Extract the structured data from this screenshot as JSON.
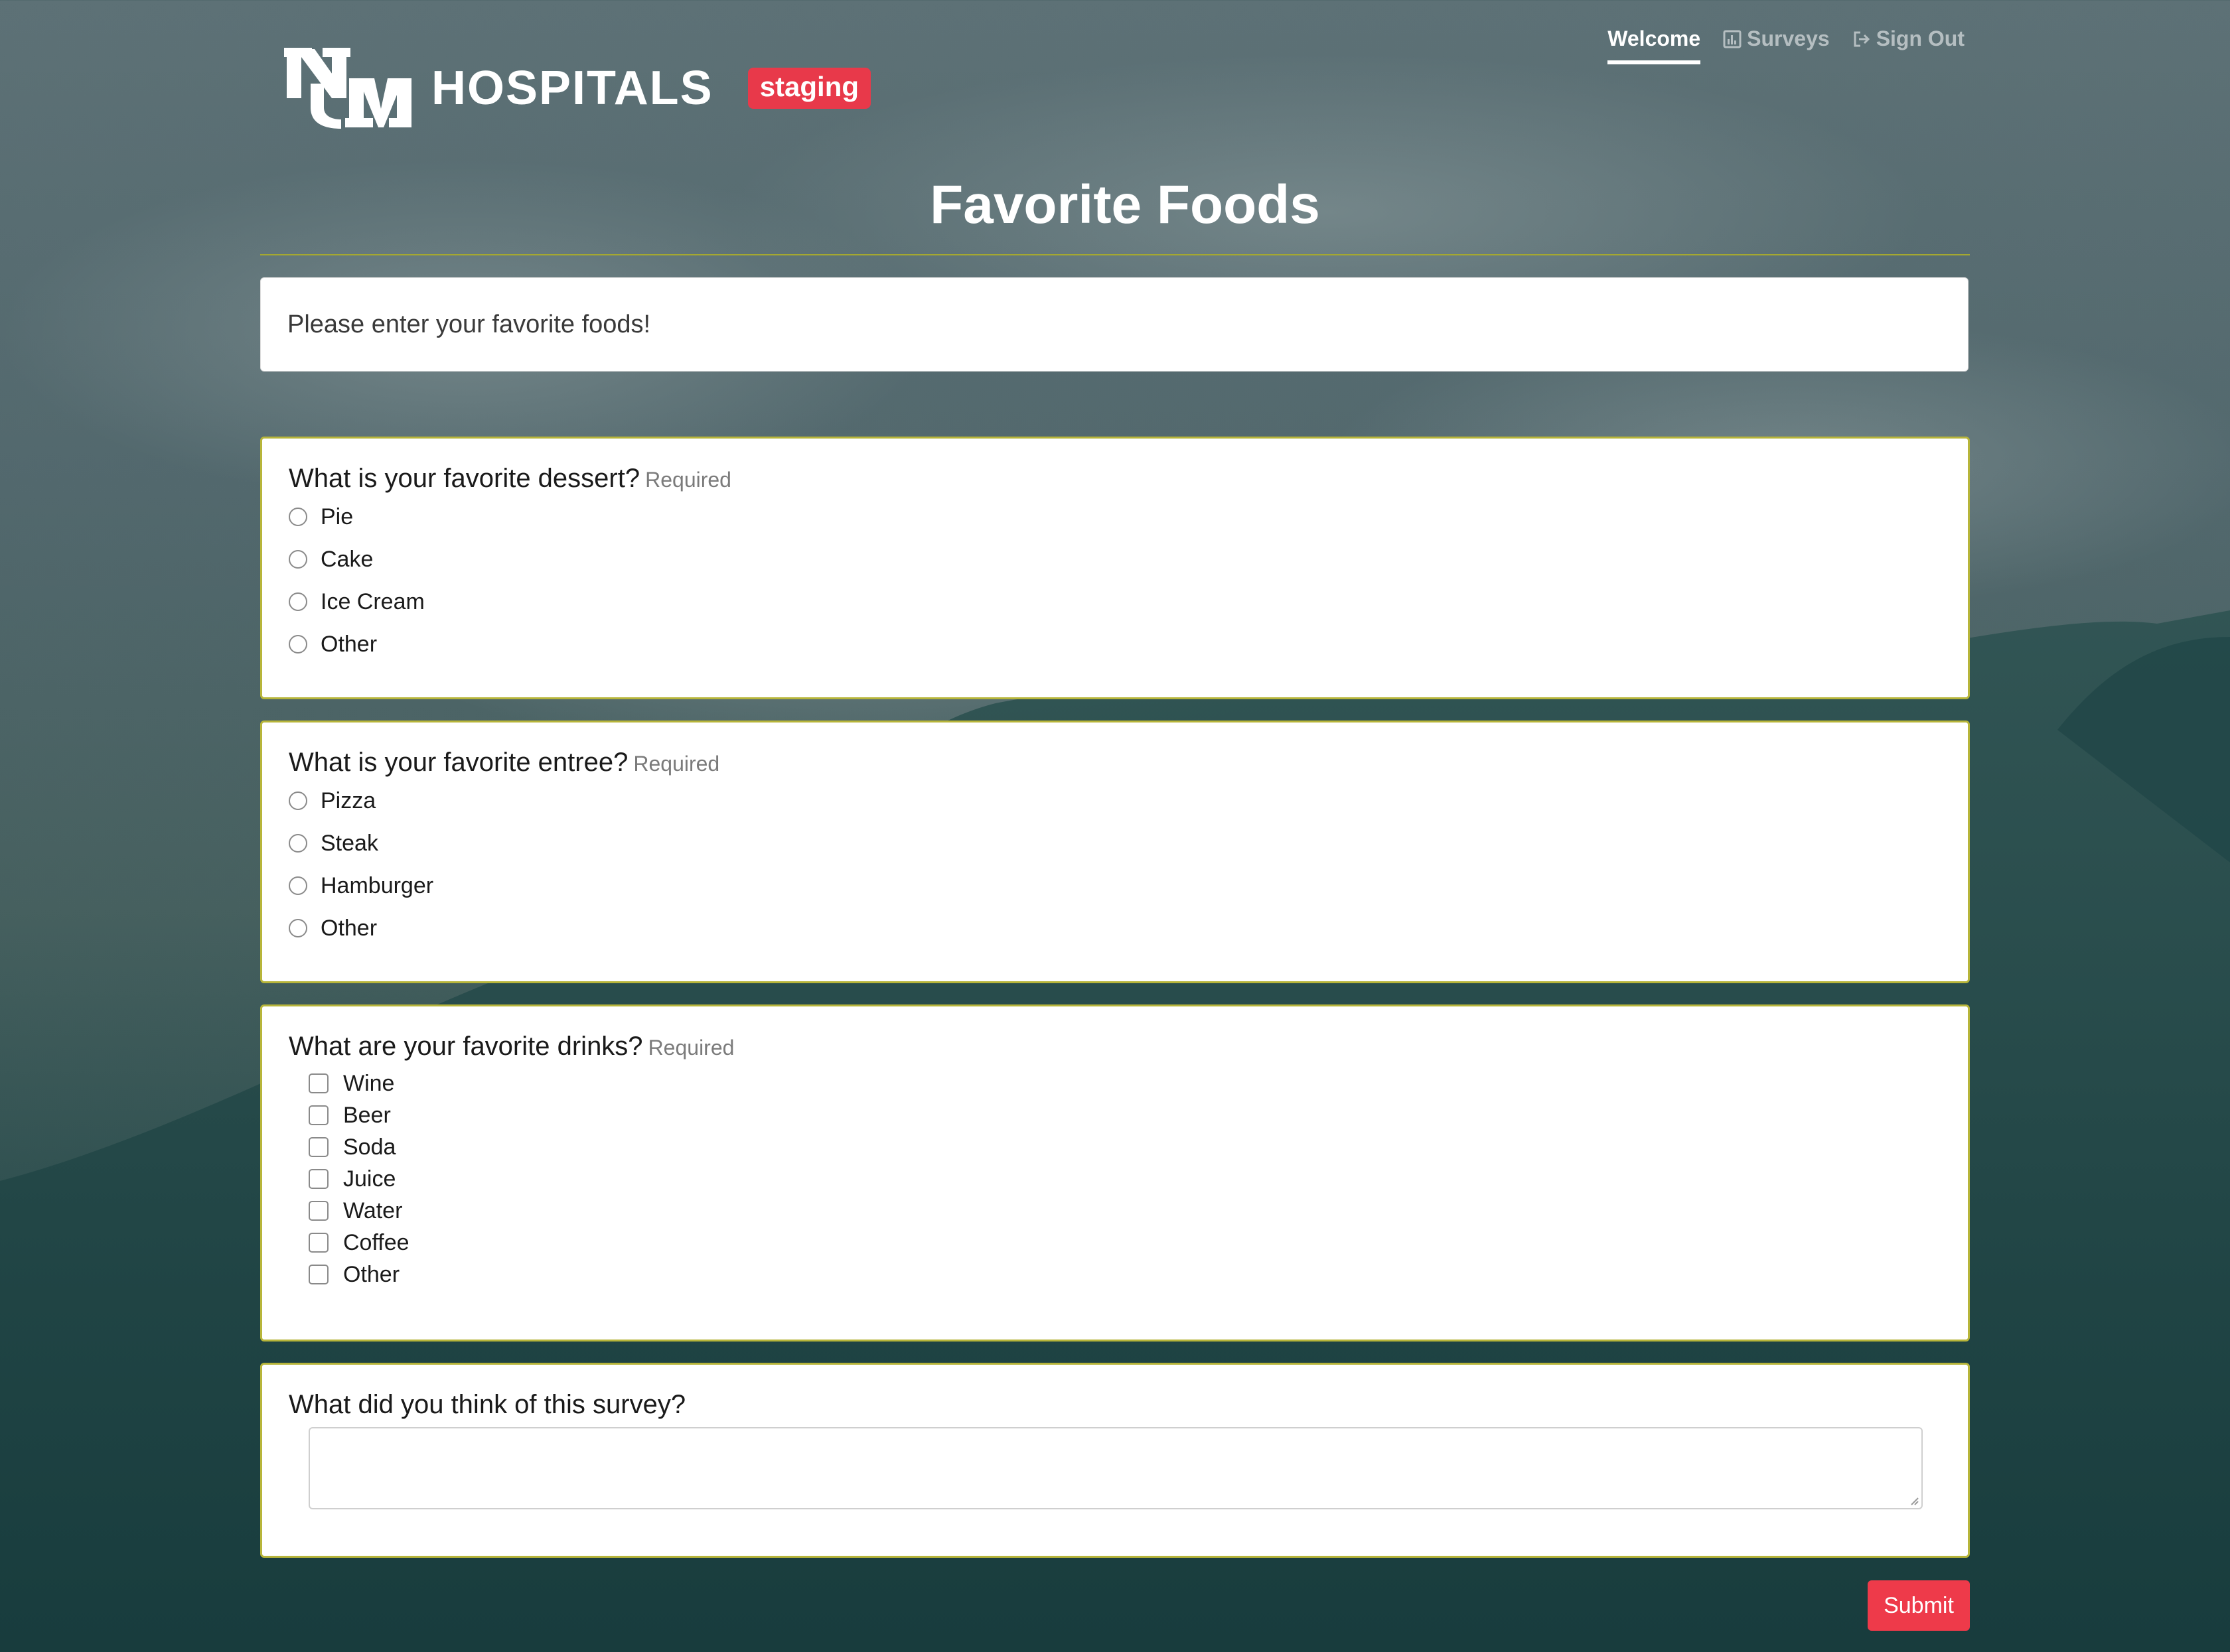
{
  "header": {
    "logo_text": "HOSPITALS",
    "logo_mark": "UNM",
    "env_badge": "staging",
    "nav": [
      {
        "label": "Welcome",
        "icon": "",
        "active": true
      },
      {
        "label": "Surveys",
        "icon": "bar-chart-icon",
        "active": false
      },
      {
        "label": "Sign Out",
        "icon": "sign-out-icon",
        "active": false
      }
    ]
  },
  "page_title": "Favorite Foods",
  "intro": "Please enter your favorite foods!",
  "required_label": "Required",
  "questions": [
    {
      "title": "What is your favorite dessert?",
      "required": true,
      "type": "radio",
      "options": [
        "Pie",
        "Cake",
        "Ice Cream",
        "Other"
      ]
    },
    {
      "title": "What is your favorite entree?",
      "required": true,
      "type": "radio",
      "options": [
        "Pizza",
        "Steak",
        "Hamburger",
        "Other"
      ]
    },
    {
      "title": "What are your favorite drinks?",
      "required": true,
      "type": "checkbox",
      "options": [
        "Wine",
        "Beer",
        "Soda",
        "Juice",
        "Water",
        "Coffee",
        "Other"
      ]
    },
    {
      "title": "What did you think of this survey?",
      "required": false,
      "type": "textarea",
      "value": ""
    }
  ],
  "submit_label": "Submit",
  "colors": {
    "accent_red": "#ee3a4a",
    "card_border": "#b7b53a",
    "badge_red": "#e8394a"
  }
}
